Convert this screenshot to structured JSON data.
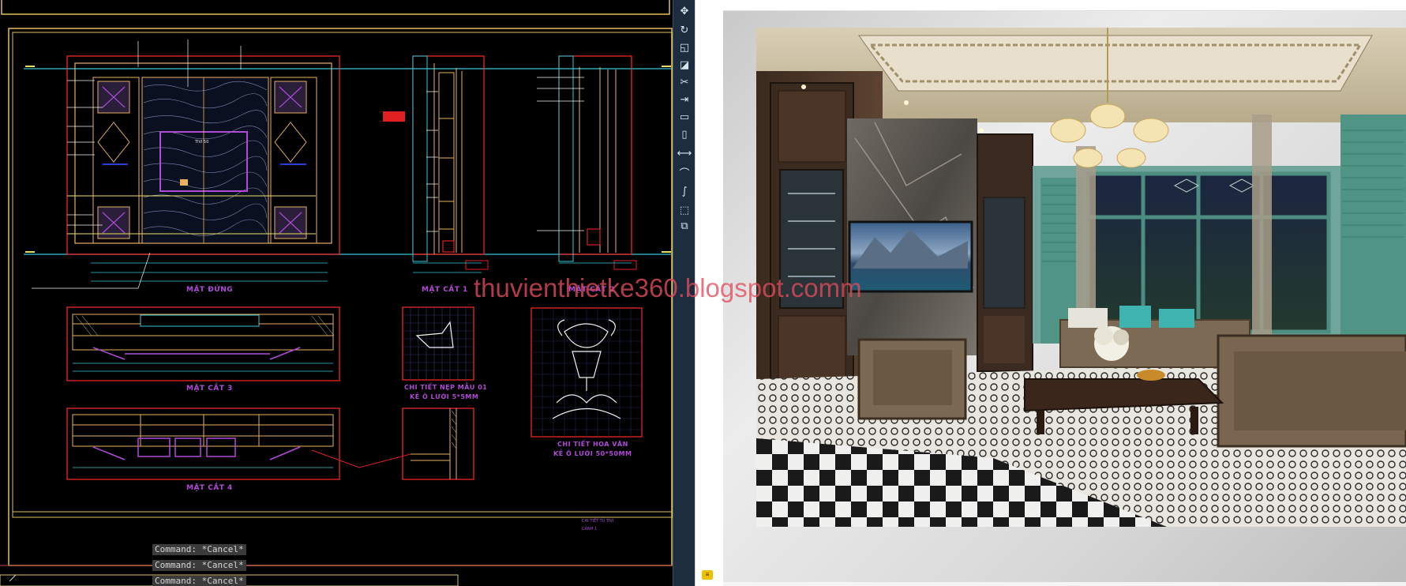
{
  "cad": {
    "labels": {
      "front_elevation": "MẶT ĐỨNG",
      "section_1": "MẶT CẮT 1",
      "section_2": "MẶT CẮT 2",
      "section_3": "MẶT CẮT 3",
      "section_4": "MẶT CẮT 4",
      "molding_detail_line1": "CHI TIẾT NẸP MẪU 01",
      "molding_detail_line2": "KẺ Ô LƯỚI 5*5MM",
      "pattern_detail_line1": "CHI TIẾT HOA VĂN",
      "pattern_detail_line2": "KẺ Ô LƯỚI 50*50MM",
      "tv_label": "TIVI 50",
      "footer_note_1": "CHI TIẾT TỦ TIVI",
      "footer_note_2": "CẢNH 1"
    },
    "command_lines": [
      "Command: *Cancel*",
      "Command: *Cancel*",
      "Command: *Cancel*"
    ],
    "colors": {
      "background": "#000000",
      "frame": "#e0c060",
      "panel": "#ff2a2a",
      "level_line": "#33c6d6",
      "wood": "#e8b060",
      "highlight": "#b04bd8"
    }
  },
  "toolbar": {
    "tools": [
      "move-icon",
      "rotate-icon",
      "scale-icon",
      "stretch-icon",
      "trim-icon",
      "extend-icon",
      "break-icon",
      "join-icon",
      "chamfer-icon",
      "fillet-icon",
      "blend-icon",
      "array-icon"
    ]
  },
  "viewer": {
    "watermark": "thuvienthietke360.blogspot.comm",
    "render_description_icon": "living-room-render-image"
  }
}
